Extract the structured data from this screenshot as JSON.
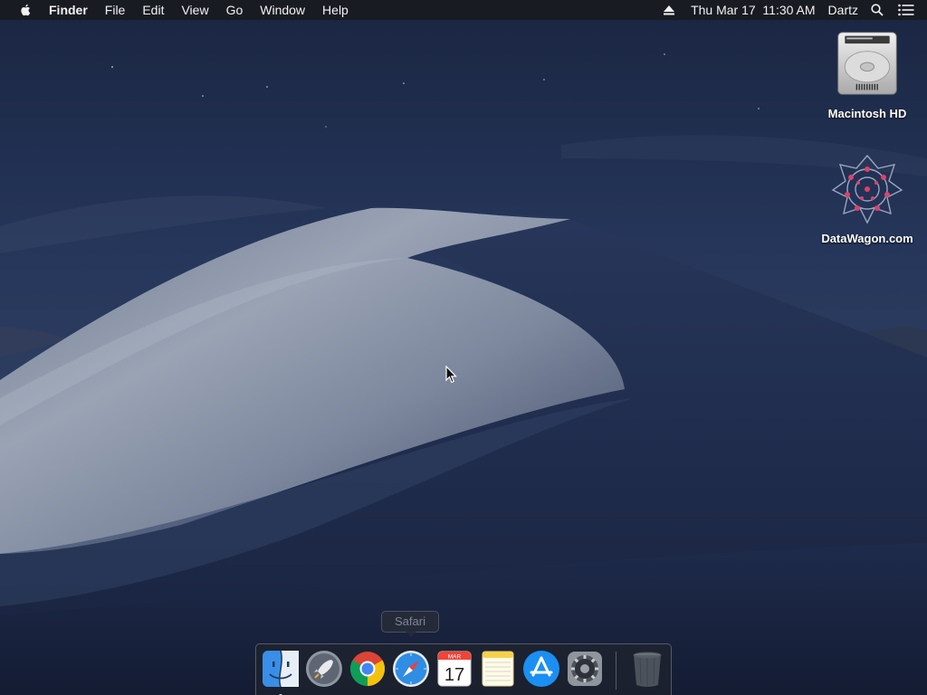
{
  "menubar": {
    "app_name": "Finder",
    "menus": [
      "File",
      "Edit",
      "View",
      "Go",
      "Window",
      "Help"
    ],
    "datetime": "Thu Mar 17  11:30 AM",
    "user": "Dartz"
  },
  "desktop": {
    "icons": [
      {
        "label": "Macintosh HD",
        "icon": "hard-drive-icon"
      },
      {
        "label": "DataWagon.com",
        "icon": "datawagon-icon"
      }
    ]
  },
  "dock": {
    "tooltip": "Safari",
    "apps": [
      {
        "name": "Finder",
        "icon": "finder-icon",
        "running": true
      },
      {
        "name": "Launchpad",
        "icon": "launchpad-icon",
        "running": false
      },
      {
        "name": "Google Chrome",
        "icon": "chrome-icon",
        "running": false
      },
      {
        "name": "Safari",
        "icon": "safari-icon",
        "running": false
      },
      {
        "name": "Calendar",
        "icon": "calendar-icon",
        "running": false
      },
      {
        "name": "Notes",
        "icon": "notes-icon",
        "running": false
      },
      {
        "name": "App Store",
        "icon": "app-store-icon",
        "running": false
      },
      {
        "name": "System Preferences",
        "icon": "system-preferences-icon",
        "running": false
      },
      {
        "name": "Trash",
        "icon": "trash-icon",
        "running": false
      }
    ],
    "calendar_month": "MAR",
    "calendar_day": "17"
  },
  "colors": {
    "sky": "#1e2c4a",
    "dune_light": "#8e97a8",
    "dune_dark": "#1a2744",
    "menubar_bg": "#181a20"
  }
}
